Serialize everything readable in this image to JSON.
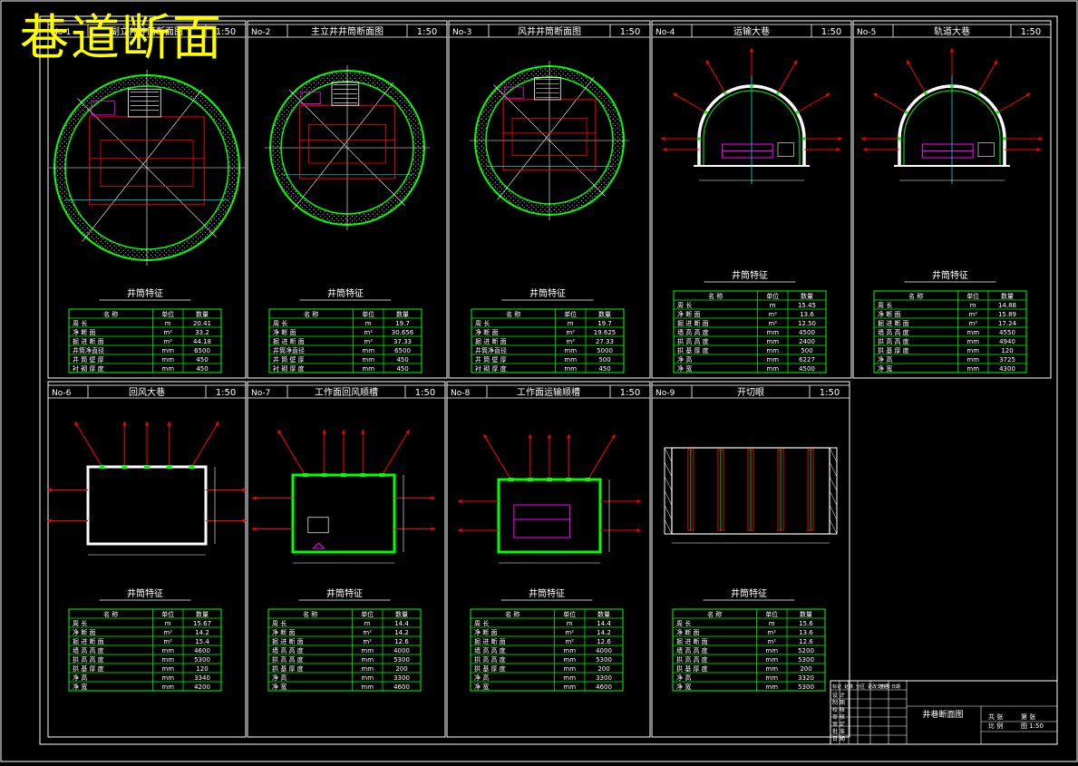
{
  "page": {
    "title": "巷道断面",
    "title_color": "#ffff00",
    "line_color": "#ffffff",
    "structure_color": "#00ff00",
    "anchor_color": "#ff0000",
    "fitting_color": "#ff00ff",
    "dimension_color": "#00ffff"
  },
  "sheets": [
    {
      "id": "sheet-1",
      "no": "No-1",
      "name": "副立井井筒断面图",
      "scale": "1:50",
      "shape": "shaft",
      "table": {
        "heading": "井筒特征",
        "cols": [
          "名 称",
          "单位",
          "数量"
        ],
        "rows": [
          [
            "周 长",
            "m",
            "20.41"
          ],
          [
            "净 断 面",
            "m²",
            "33.2"
          ],
          [
            "掘 进 断 面",
            "m²",
            "44.18"
          ],
          [
            "井筒净直径",
            "mm",
            "6500"
          ],
          [
            "井 筒 壁 厚",
            "mm",
            "450"
          ],
          [
            "衬 砌 厚 度",
            "mm",
            "450"
          ]
        ]
      }
    },
    {
      "id": "sheet-2",
      "no": "No-2",
      "name": "主立井井筒断面图",
      "scale": "1:50",
      "shape": "shaft",
      "table": {
        "heading": "井筒特征",
        "cols": [
          "名 称",
          "单位",
          "数量"
        ],
        "rows": [
          [
            "周 长",
            "m",
            "19.7"
          ],
          [
            "净 断 面",
            "m²",
            "30.656"
          ],
          [
            "掘 进 断 面",
            "m²",
            "37.33"
          ],
          [
            "井筒净直径",
            "mm",
            "6500"
          ],
          [
            "井 筒 壁 厚",
            "mm",
            "450"
          ],
          [
            "衬 砌 厚 度",
            "mm",
            "450"
          ]
        ]
      }
    },
    {
      "id": "sheet-3",
      "no": "No-3",
      "name": "风井井筒断面图",
      "scale": "1:50",
      "shape": "shaft",
      "table": {
        "heading": "井筒特征",
        "cols": [
          "名 称",
          "单位",
          "数量"
        ],
        "rows": [
          [
            "周 长",
            "m",
            "19.7"
          ],
          [
            "净 断 面",
            "m²",
            "19.625"
          ],
          [
            "掘 进 断 面",
            "m²",
            "27.33"
          ],
          [
            "井筒净直径",
            "mm",
            "5000"
          ],
          [
            "井 筒 壁 厚",
            "mm",
            "500"
          ],
          [
            "衬 砌 厚 度",
            "mm",
            "450"
          ]
        ]
      }
    },
    {
      "id": "sheet-4",
      "no": "No-4",
      "name": "运输大巷",
      "scale": "1:50",
      "shape": "arch",
      "table": {
        "heading": "井筒特征",
        "cols": [
          "名 称",
          "单位",
          "数量"
        ],
        "rows": [
          [
            "周 长",
            "m",
            "15.45"
          ],
          [
            "净 断 面",
            "m²",
            "13.6"
          ],
          [
            "掘 进 断 面",
            "m²",
            "12.50"
          ],
          [
            "墙 高 高 度",
            "mm",
            "4500"
          ],
          [
            "拱 高 高 度",
            "mm",
            "2400"
          ],
          [
            "拱 基 厚 度",
            "mm",
            "500"
          ],
          [
            "净 高",
            "mm",
            "6227"
          ],
          [
            "净 宽",
            "mm",
            "4500"
          ]
        ]
      }
    },
    {
      "id": "sheet-5",
      "no": "No-5",
      "name": "轨道大巷",
      "scale": "1:50",
      "shape": "arch",
      "table": {
        "heading": "井筒特征",
        "cols": [
          "名 称",
          "单位",
          "数量"
        ],
        "rows": [
          [
            "周 长",
            "m",
            "14.88"
          ],
          [
            "净 断 面",
            "m²",
            "15.89"
          ],
          [
            "掘 进 断 面",
            "m²",
            "17.24"
          ],
          [
            "墙 高 高 度",
            "mm",
            "4550"
          ],
          [
            "拱 高 高 度",
            "mm",
            "4940"
          ],
          [
            "拱 基 厚 度",
            "mm",
            "120"
          ],
          [
            "净 高",
            "mm",
            "3725"
          ],
          [
            "净 宽",
            "mm",
            "4300"
          ]
        ]
      }
    },
    {
      "id": "sheet-6",
      "no": "No-6",
      "name": "回风大巷",
      "scale": "1:50",
      "shape": "rect-return",
      "table": {
        "heading": "井筒特征",
        "cols": [
          "名 称",
          "单位",
          "数量"
        ],
        "rows": [
          [
            "周 长",
            "m",
            "15.67"
          ],
          [
            "净 断 面",
            "m²",
            "14.2"
          ],
          [
            "掘 进 断 面",
            "m²",
            "15.4"
          ],
          [
            "墙 高 高 度",
            "mm",
            "4600"
          ],
          [
            "拱 高 高 度",
            "mm",
            "5300"
          ],
          [
            "拱 基 厚 度",
            "mm",
            "120"
          ],
          [
            "净 高",
            "mm",
            "3340"
          ],
          [
            "净 宽",
            "mm",
            "4200"
          ]
        ]
      }
    },
    {
      "id": "sheet-7",
      "no": "No-7",
      "name": "工作面回风顺槽",
      "scale": "1:50",
      "shape": "rect-return-face",
      "table": {
        "heading": "井筒特征",
        "cols": [
          "名 称",
          "单位",
          "数量"
        ],
        "rows": [
          [
            "周 长",
            "m",
            "14.4"
          ],
          [
            "净 断 面",
            "m²",
            "14.2"
          ],
          [
            "掘 进 断 面",
            "m²",
            "12.6"
          ],
          [
            "墙 高 高 度",
            "mm",
            "4000"
          ],
          [
            "拱 高 高 度",
            "mm",
            "5300"
          ],
          [
            "拱 基 厚 度",
            "mm",
            "200"
          ],
          [
            "净 高",
            "mm",
            "3300"
          ],
          [
            "净 宽",
            "mm",
            "4600"
          ]
        ]
      }
    },
    {
      "id": "sheet-8",
      "no": "No-8",
      "name": "工作面运输顺槽",
      "scale": "1:50",
      "shape": "rect-haulage",
      "table": {
        "heading": "井筒特征",
        "cols": [
          "名 称",
          "单位",
          "数量"
        ],
        "rows": [
          [
            "周 长",
            "m",
            "14.4"
          ],
          [
            "净 断 面",
            "m²",
            "14.2"
          ],
          [
            "掘 进 断 面",
            "m²",
            "12.6"
          ],
          [
            "墙 高 高 度",
            "mm",
            "4000"
          ],
          [
            "拱 高 高 度",
            "mm",
            "5300"
          ],
          [
            "拱 基 厚 度",
            "mm",
            "200"
          ],
          [
            "净 高",
            "mm",
            "3300"
          ],
          [
            "净 宽",
            "mm",
            "4600"
          ]
        ]
      }
    },
    {
      "id": "sheet-9",
      "no": "No-9",
      "name": "开切眼",
      "scale": "1:50",
      "shape": "cut",
      "table": {
        "heading": "井筒特征",
        "cols": [
          "名 称",
          "单位",
          "数量"
        ],
        "rows": [
          [
            "周 长",
            "m",
            "15.6"
          ],
          [
            "净 断 面",
            "m²",
            "13.6"
          ],
          [
            "掘 进 断 面",
            "m²",
            "12.6"
          ],
          [
            "墙 高 高 度",
            "mm",
            "5200"
          ],
          [
            "拱 高 高 度",
            "mm",
            "5300"
          ],
          [
            "拱 基 厚 度",
            "mm",
            "200"
          ],
          [
            "净 高",
            "mm",
            "3320"
          ],
          [
            "净 宽",
            "mm",
            "5300"
          ]
        ]
      }
    }
  ],
  "title_block": {
    "drawing_name": "井巷断面图",
    "left_labels": [
      "设 计",
      "制 图",
      "校 核",
      "审 核",
      "审 定",
      "批 准",
      "日 期"
    ],
    "header_labels": [
      "标记",
      "处数",
      "分区",
      "更改文件号",
      "签名",
      "日期"
    ],
    "right_rows": [
      [
        "共 张",
        "第 张"
      ],
      [
        "比 例",
        "图 1:50"
      ]
    ]
  }
}
